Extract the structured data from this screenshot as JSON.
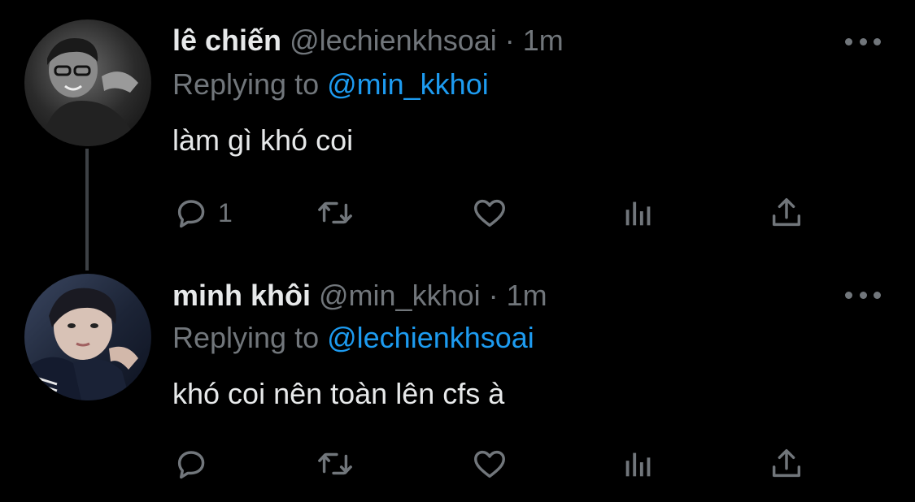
{
  "tweets": [
    {
      "display_name": "lê chiến",
      "handle": "@lechienkhsoai",
      "separator": "·",
      "time": "1m",
      "replying_label": "Replying to",
      "replying_to": "@min_kkhoi",
      "text": "làm gì khó coi",
      "reply_count": "1",
      "avatar": "avatar-grayscale-person-with-glasses"
    },
    {
      "display_name": "minh khôi",
      "handle": "@min_kkhoi",
      "separator": "·",
      "time": "1m",
      "replying_label": "Replying to",
      "replying_to": "@lechienkhsoai",
      "text": "khó coi nên toàn lên cfs à",
      "reply_count": "",
      "avatar": "avatar-person-in-dark-jacket"
    }
  ],
  "icons": {
    "more": "more-dots-icon",
    "reply": "reply-bubble-icon",
    "retweet": "retweet-arrows-icon",
    "like": "heart-icon",
    "stats": "bar-chart-icon",
    "share": "share-upload-icon"
  },
  "colors": {
    "background": "#000000",
    "text_primary": "#e7e9ea",
    "text_secondary": "#71767b",
    "accent": "#1d9bf0",
    "thread_line": "#3d4145"
  }
}
